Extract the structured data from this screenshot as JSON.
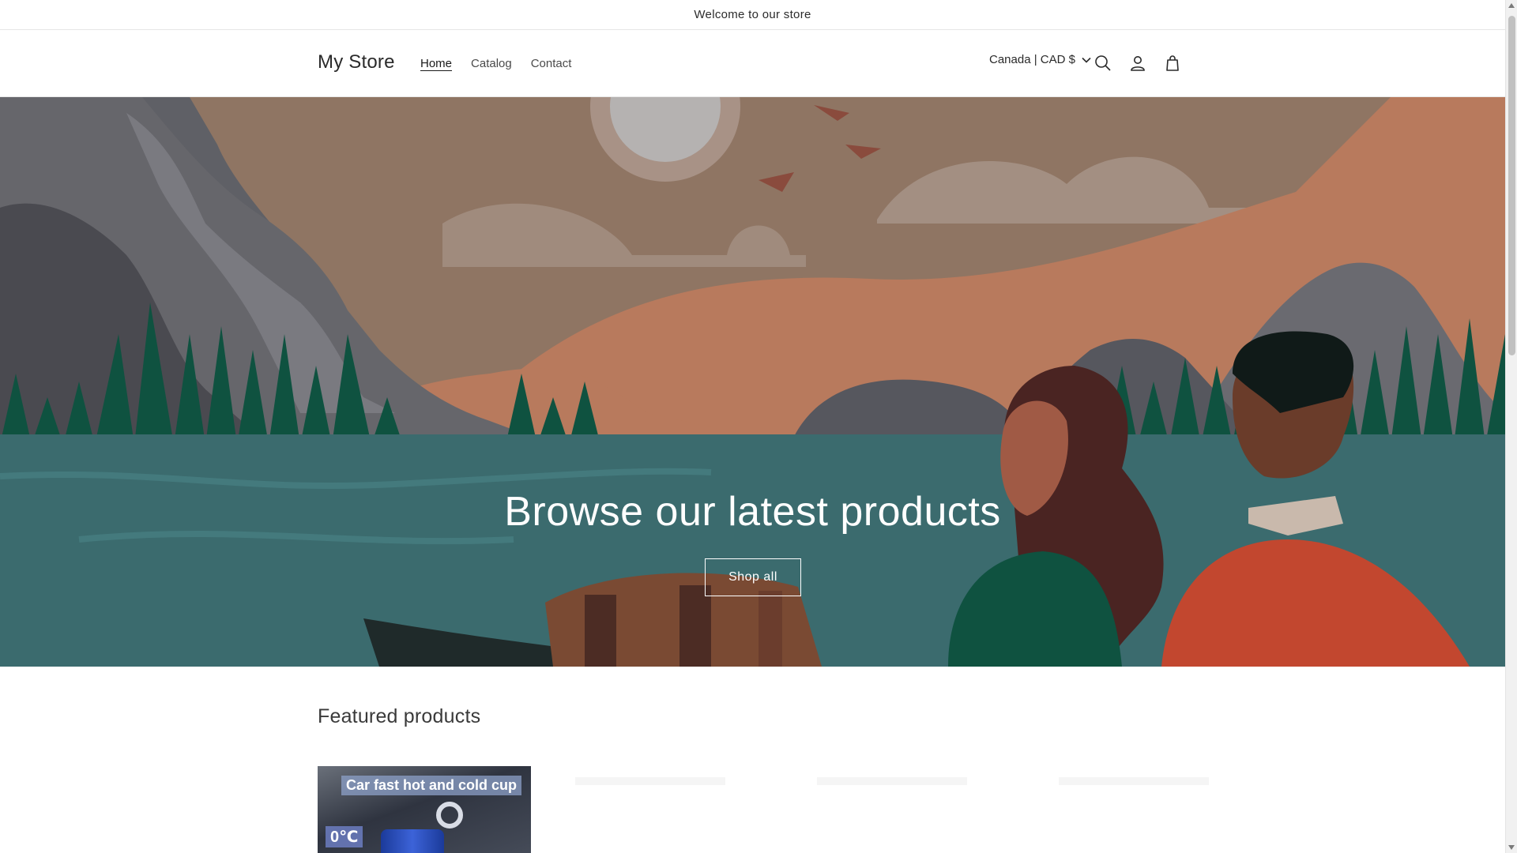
{
  "announcement": {
    "text": "Welcome to our store"
  },
  "header": {
    "logo": "My Store",
    "nav": [
      {
        "label": "Home",
        "active": true
      },
      {
        "label": "Catalog",
        "active": false
      },
      {
        "label": "Contact",
        "active": false
      }
    ],
    "locale": "Canada | CAD $",
    "icons": [
      "search-icon",
      "account-icon",
      "cart-icon",
      "chevron-down-icon"
    ]
  },
  "hero": {
    "title": "Browse our latest products",
    "button_label": "Shop all"
  },
  "featured": {
    "title": "Featured products",
    "products": [
      {
        "banner": "Car fast hot and cold cup",
        "temp": "0℃"
      }
    ]
  },
  "colors": {
    "sky": "#8f7563",
    "water": "#3b6b6e",
    "forest": "#0f5240",
    "mountain": "#5f6066",
    "text": "#121212"
  }
}
